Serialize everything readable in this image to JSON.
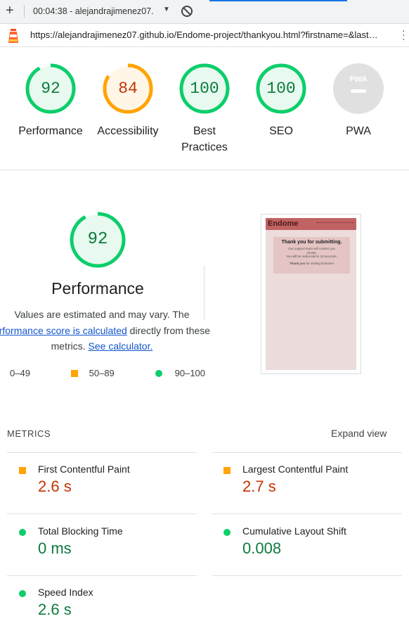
{
  "toolbar": {
    "new_tab_icon": "plus-icon",
    "timestamp_label": "00:04:38 - alejandrajimenez07.",
    "dropdown_icon": "caret-down-icon",
    "clear_icon": "block-icon"
  },
  "urlbar": {
    "icon": "lighthouse-icon",
    "url": "https://alejandrajimenez07.github.io/Endome-project/thankyou.html?firstname=&last…",
    "menu_icon": "more-vert-icon"
  },
  "gauges": [
    {
      "score": "92",
      "label": "Performance",
      "status": "pass"
    },
    {
      "score": "84",
      "label": "Accessibility",
      "status": "average"
    },
    {
      "score": "100",
      "label_line1": "Best",
      "label_line2": "Practices",
      "status": "pass"
    },
    {
      "score": "100",
      "label": "SEO",
      "status": "pass"
    },
    {
      "badge": "PWA",
      "label": "PWA",
      "status": "na"
    }
  ],
  "performance": {
    "score": "92",
    "title": "Performance",
    "desc_1": "Values are estimated and may vary. The",
    "desc_link": "erformance score is calculated",
    "desc_2": " directly from these",
    "desc_3": "metrics. ",
    "calc_link": "See calculator.",
    "legend": {
      "fail": "0–49",
      "average": "50–89",
      "pass": "90–100"
    }
  },
  "thumbnail": {
    "brand": "Endome",
    "heading": "Thank you for submitting.",
    "line1": "Our support team will contact you",
    "line2": "shortly.",
    "line3": "You will be redirected in 10 seconds.",
    "line4_bold": "Thank you",
    "line4": " for visiting Endome!"
  },
  "metrics": {
    "heading": "METRICS",
    "expand_label": "Expand view",
    "items": [
      {
        "name": "First Contentful Paint",
        "value": "2.6 s",
        "rating": "average"
      },
      {
        "name": "Largest Contentful Paint",
        "value": "2.7 s",
        "rating": "average"
      },
      {
        "name": "Total Blocking Time",
        "value": "0 ms",
        "rating": "pass"
      },
      {
        "name": "Cumulative Layout Shift",
        "value": "0.008",
        "rating": "pass"
      },
      {
        "name": "Speed Index",
        "value": "2.6 s",
        "rating": "pass"
      }
    ]
  },
  "colors": {
    "pass": "#0cce6b",
    "average": "#ffa400",
    "pass_text": "#0c7a3e",
    "average_text": "#c33300"
  }
}
